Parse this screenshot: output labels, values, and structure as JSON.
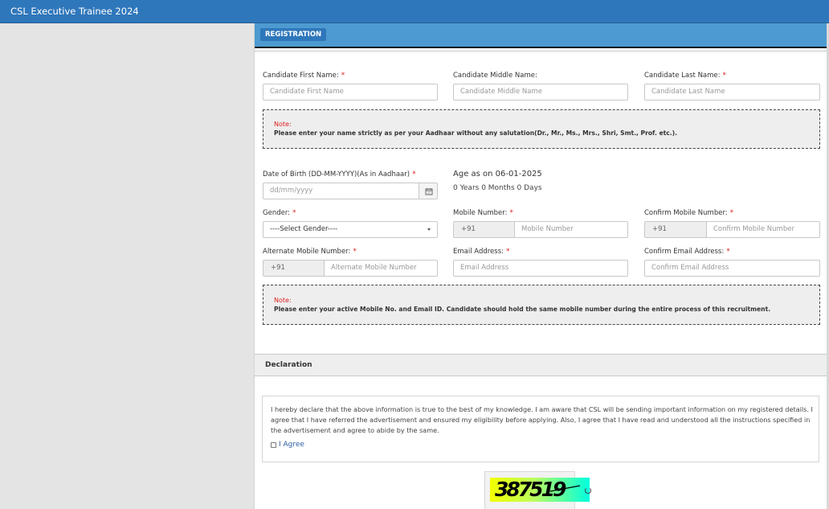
{
  "app": {
    "title": "CSL Executive Trainee 2024"
  },
  "registration": {
    "tab_label": "REGISTRATION",
    "fields": {
      "first_name": {
        "label": "Candidate First Name:",
        "placeholder": "Candidate First Name",
        "required": "*"
      },
      "middle_name": {
        "label": "Candidate Middle Name:",
        "placeholder": "Candidate Middle Name"
      },
      "last_name": {
        "label": "Candidate Last Name:",
        "placeholder": "Candidate Last Name",
        "required": "*"
      },
      "dob": {
        "label": "Date of Birth (DD-MM-YYYY)(As in Aadhaar)",
        "placeholder": "dd/mm/yyyy",
        "required": "*"
      },
      "gender": {
        "label": "Gender:",
        "selected": "----Select Gender----",
        "required": "*"
      },
      "mobile": {
        "label": "Mobile Number:",
        "prefix": "+91",
        "placeholder": "Mobile Number",
        "required": "*"
      },
      "confirm_mobile": {
        "label": "Confirm Mobile Number:",
        "prefix": "+91",
        "placeholder": "Confirm Mobile Number",
        "required": "*"
      },
      "alt_mobile": {
        "label": "Alternate Mobile Number:",
        "prefix": "+91",
        "placeholder": "Alternate Mobile Number",
        "required": "*"
      },
      "email": {
        "label": "Email Address:",
        "placeholder": "Email Address",
        "required": "*"
      },
      "confirm_email": {
        "label": "Confirm Email Address:",
        "placeholder": "Confirm Email Address",
        "required": "*"
      }
    },
    "age": {
      "title": "Age as on 06-01-2025",
      "value": "0 Years 0 Months 0 Days"
    },
    "notes": [
      {
        "title": "Note:",
        "text": "Please enter your name strictly as per your Aadhaar without any salutation(Dr., Mr., Ms., Mrs., Shri, Smt., Prof. etc.)."
      },
      {
        "title": "Note:",
        "text": "Please enter your active Mobile No. and Email ID. Candidate should hold the same mobile number during the entire process of this recruitment."
      }
    ]
  },
  "declaration": {
    "title": "Declaration",
    "text": "I hereby declare that the above information is true to the best of my knowledge. I am aware that CSL will be sending important information on my registered details. I agree that I have referred the advertisement and ensured my eligibility before applying. Also, I agree that I have read and understood all the instructions specified in the advertisement and agree to abide by the same.",
    "agree_label": "I Agree"
  },
  "captcha": {
    "code": "387519"
  }
}
